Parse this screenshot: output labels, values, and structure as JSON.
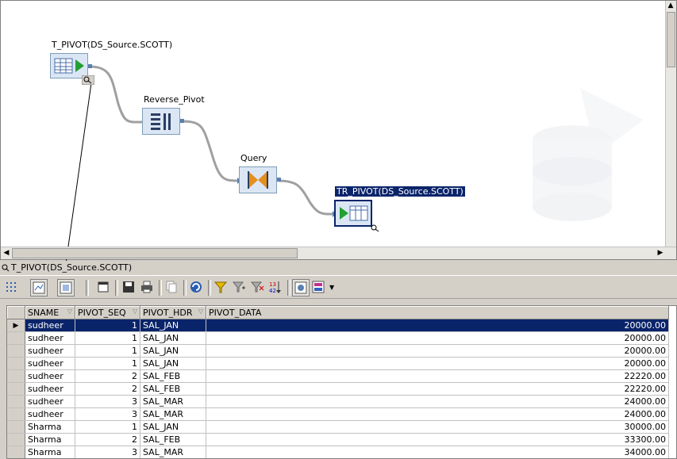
{
  "canvas": {
    "nodes": {
      "source": {
        "label": "T_PIVOT(DS_Source.SCOTT)"
      },
      "reverse_pivot": {
        "label": "Reverse_Pivot"
      },
      "query": {
        "label": "Query"
      },
      "target": {
        "label": "TR_PIVOT(DS_Source.SCOTT)"
      }
    }
  },
  "panel": {
    "title": "T_PIVOT(DS_Source.SCOTT)"
  },
  "grid": {
    "columns": [
      "SNAME",
      "PIVOT_SEQ",
      "PIVOT_HDR",
      "PIVOT_DATA"
    ],
    "rows": [
      [
        "sudheer",
        "1",
        "SAL_JAN",
        "20000.00"
      ],
      [
        "sudheer",
        "1",
        "SAL_JAN",
        "20000.00"
      ],
      [
        "sudheer",
        "1",
        "SAL_JAN",
        "20000.00"
      ],
      [
        "sudheer",
        "1",
        "SAL_JAN",
        "20000.00"
      ],
      [
        "sudheer",
        "2",
        "SAL_FEB",
        "22220.00"
      ],
      [
        "sudheer",
        "2",
        "SAL_FEB",
        "22220.00"
      ],
      [
        "sudheer",
        "3",
        "SAL_MAR",
        "24000.00"
      ],
      [
        "sudheer",
        "3",
        "SAL_MAR",
        "24000.00"
      ],
      [
        "Sharma",
        "1",
        "SAL_JAN",
        "30000.00"
      ],
      [
        "Sharma",
        "2",
        "SAL_FEB",
        "33300.00"
      ],
      [
        "Sharma",
        "3",
        "SAL_MAR",
        "34000.00"
      ]
    ],
    "selected_row": 0
  },
  "colors": {
    "selection": "#0a246a",
    "accent": "#5a7fb0"
  }
}
